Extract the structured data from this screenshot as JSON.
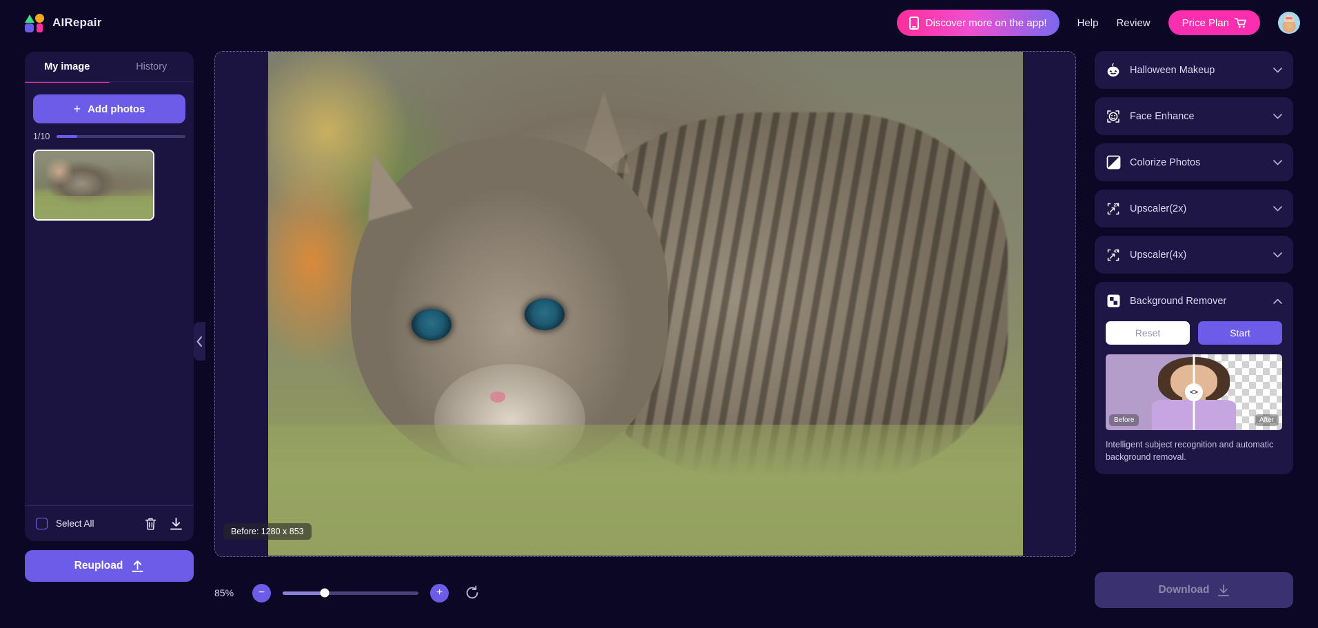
{
  "app": {
    "name": "AIRepair"
  },
  "header": {
    "discover_label": "Discover more on the app!",
    "help_label": "Help",
    "review_label": "Review",
    "price_plan_label": "Price Plan"
  },
  "sidebar": {
    "tabs": [
      {
        "label": "My image",
        "active": true
      },
      {
        "label": "History",
        "active": false
      }
    ],
    "add_photos_label": "Add photos",
    "count_label": "1/10",
    "count_progress_percent": 16,
    "select_all_label": "Select All",
    "reupload_label": "Reupload"
  },
  "canvas": {
    "before_badge": "Before: 1280 x 853"
  },
  "zoom_bar": {
    "percent_label": "85%",
    "slider_percent": 31,
    "minus_label": "−",
    "plus_label": "+"
  },
  "tools": [
    {
      "label": "Halloween Makeup",
      "icon": "pumpkin-icon",
      "expanded": false
    },
    {
      "label": "Face Enhance",
      "icon": "face-icon",
      "expanded": false
    },
    {
      "label": "Colorize Photos",
      "icon": "colorize-icon",
      "expanded": false
    },
    {
      "label": "Upscaler(2x)",
      "icon": "upscale-2x-icon",
      "expanded": false
    },
    {
      "label": "Upscaler(4x)",
      "icon": "upscale-4x-icon",
      "expanded": false
    },
    {
      "label": "Background Remover",
      "icon": "checkerboard-icon",
      "expanded": true
    }
  ],
  "background_remover": {
    "title": "Background Remover",
    "reset_label": "Reset",
    "start_label": "Start",
    "before_tag": "Before",
    "after_tag": "After",
    "description": "Intelligent subject recognition and automatic background removal."
  },
  "footer": {
    "download_label": "Download"
  },
  "colors": {
    "background": "#0c0725",
    "panel": "#1b1440",
    "accent_purple": "#6c5ce7",
    "accent_pink": "#ff2ea6",
    "price_pink": "#fc2eb0"
  }
}
